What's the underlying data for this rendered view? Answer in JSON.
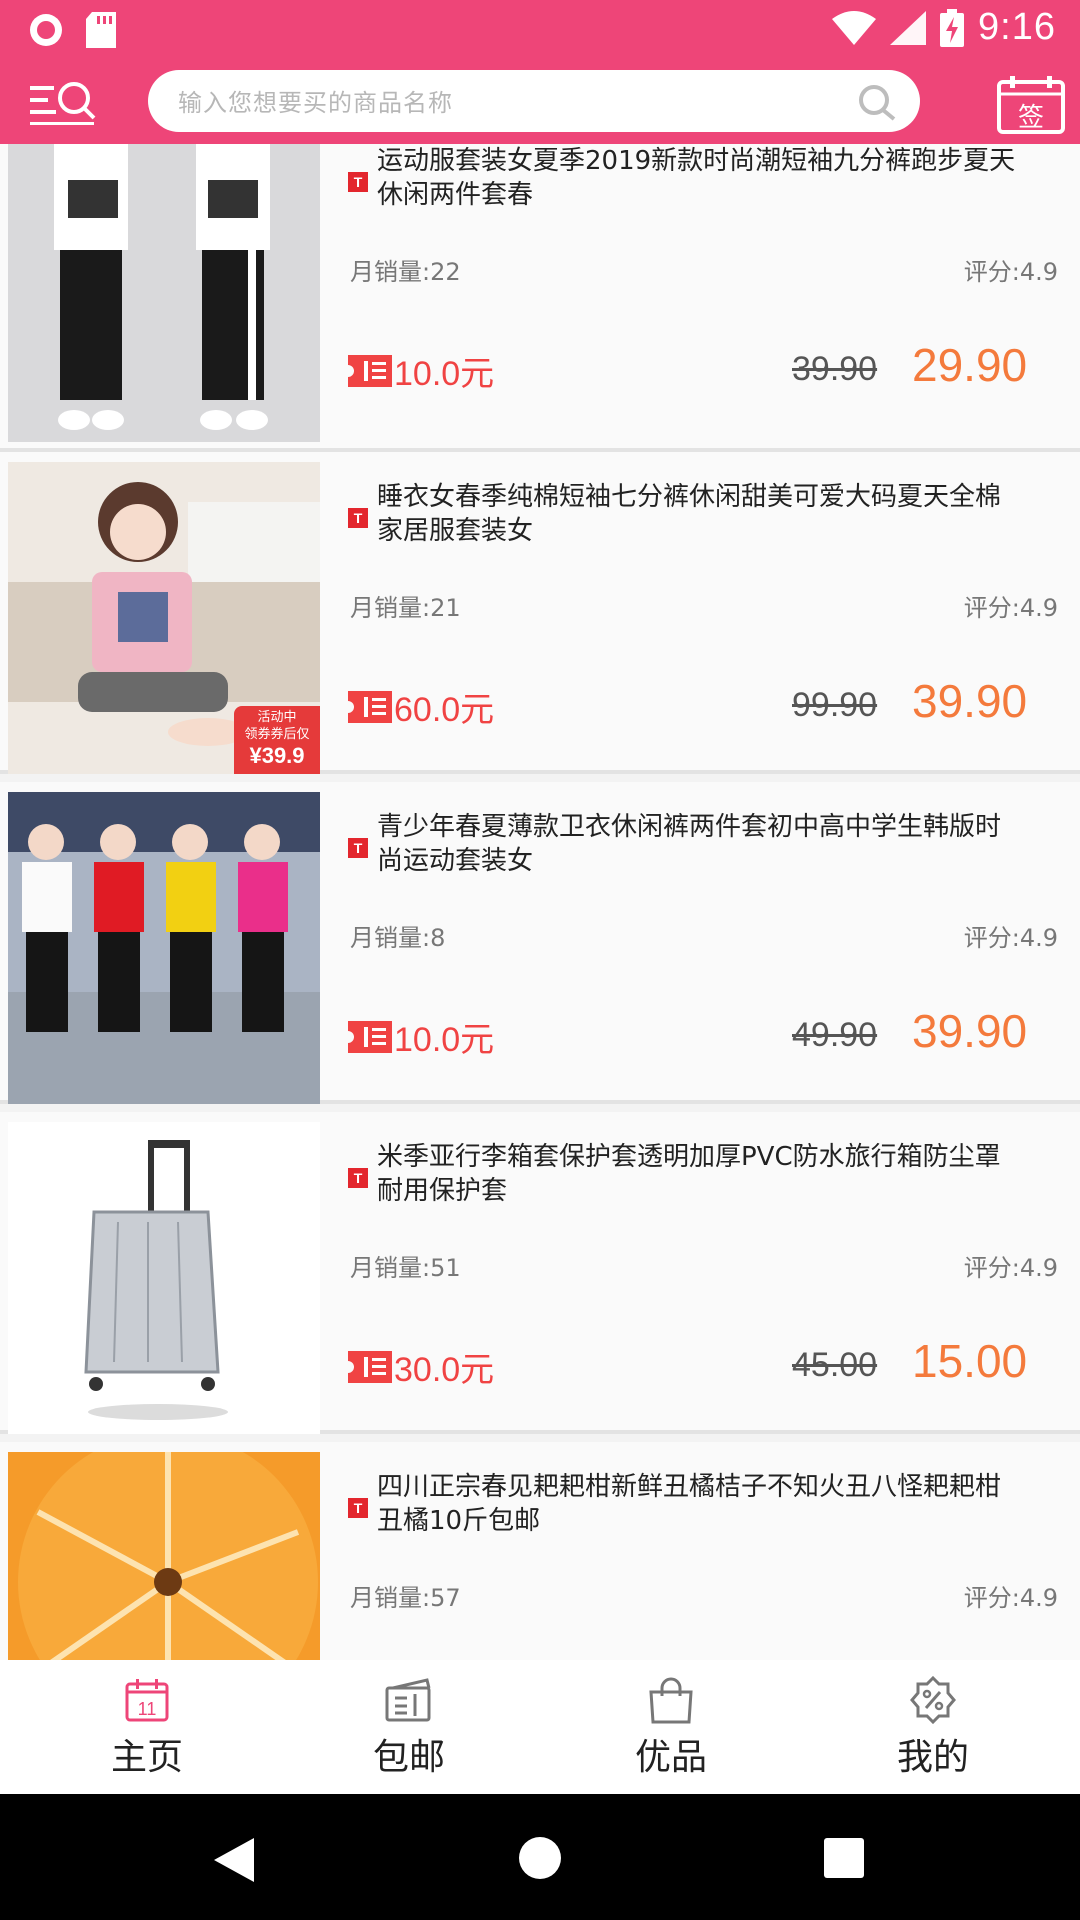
{
  "status": {
    "time": "9:16"
  },
  "header": {
    "search_placeholder": "输入您想要买的商品名称",
    "sign_label": "签"
  },
  "products": [
    {
      "title": "运动服套装女夏季2019新款时尚潮短袖九分裤跑步夏天休闲两件套春",
      "sales": "月销量:22",
      "rating": "评分:4.9",
      "coupon": "10.0元",
      "original_price": "39.90",
      "price": "29.90"
    },
    {
      "title": "睡衣女春季纯棉短袖七分裤休闲甜美可爱大码夏天全棉家居服套装女",
      "sales": "月销量:21",
      "rating": "评分:4.9",
      "coupon": "60.0元",
      "original_price": "99.90",
      "price": "39.90",
      "badge_line1": "活动中",
      "badge_line2": "领券券后仅",
      "badge_price": "¥39.9"
    },
    {
      "title": "青少年春夏薄款卫衣休闲裤两件套初中高中学生韩版时尚运动套装女",
      "sales": "月销量:8",
      "rating": "评分:4.9",
      "coupon": "10.0元",
      "original_price": "49.90",
      "price": "39.90"
    },
    {
      "title": "米季亚行李箱套保护套透明加厚PVC防水旅行箱防尘罩耐用保护套",
      "sales": "月销量:51",
      "rating": "评分:4.9",
      "coupon": "30.0元",
      "original_price": "45.00",
      "price": "15.00"
    },
    {
      "title": "四川正宗春见耙耙柑新鲜丑橘桔子不知火丑八怪耙耙柑丑橘10斤包邮",
      "sales": "月销量:57",
      "rating": "评分:4.9"
    }
  ],
  "nav": {
    "home": "主页",
    "free_shipping": "包邮",
    "quality": "优品",
    "mine": "我的",
    "home_icon_num": "11"
  },
  "colors": {
    "brand": "#ee4578",
    "coupon": "#f04343",
    "price": "#f47a3c"
  }
}
